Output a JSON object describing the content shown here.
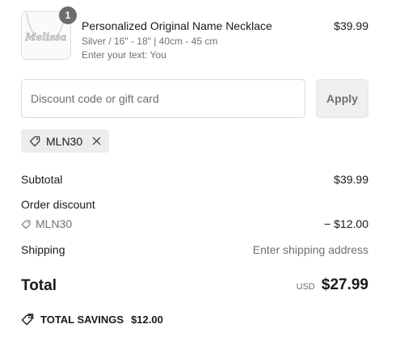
{
  "product": {
    "quantity": "1",
    "name": "Personalized Original Name Necklace",
    "variant": "Silver / 16\" - 18\" | 40cm - 45 cm",
    "custom_text": "Enter your text: You",
    "price": "$39.99",
    "thumbnail_text": "Melissa"
  },
  "discount": {
    "placeholder": "Discount code or gift card",
    "apply_label": "Apply",
    "applied_code": "MLN30"
  },
  "summary": {
    "subtotal_label": "Subtotal",
    "subtotal_value": "$39.99",
    "order_discount_label": "Order discount",
    "discount_code": "MLN30",
    "discount_value": "− $12.00",
    "shipping_label": "Shipping",
    "shipping_value": "Enter shipping address",
    "total_label": "Total",
    "currency": "USD",
    "total_value": "$27.99",
    "savings_label": "TOTAL SAVINGS",
    "savings_value": "$12.00"
  },
  "icons": {
    "tag": "tag-icon",
    "close": "close-icon",
    "savings": "savings-tag-icon"
  }
}
